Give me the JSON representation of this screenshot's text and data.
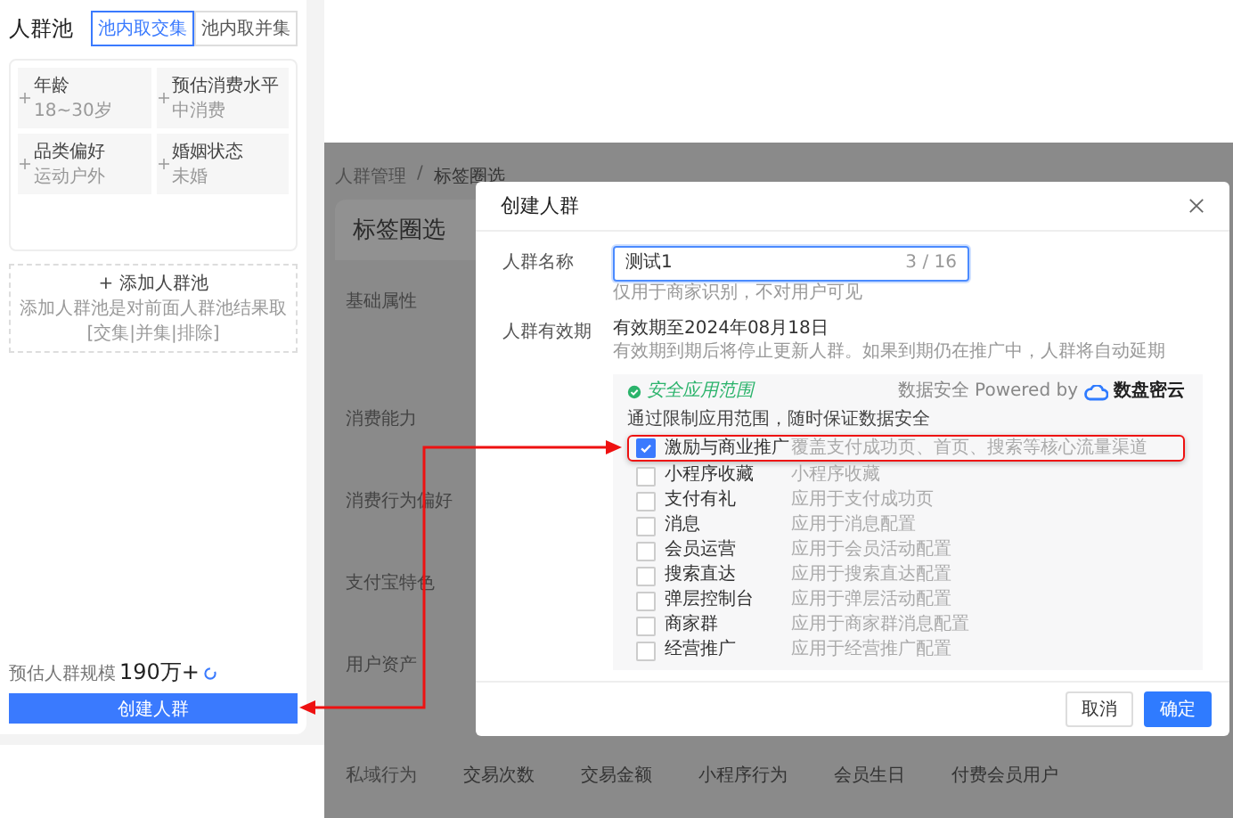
{
  "pool_panel": {
    "title": "人群池",
    "tabs": [
      {
        "label": "池内取交集",
        "selected": true
      },
      {
        "label": "池内取并集",
        "selected": false
      }
    ],
    "conditions": [
      {
        "name": "年龄",
        "value": "18~30岁"
      },
      {
        "name": "预估消费水平",
        "value": "中消费"
      },
      {
        "name": "品类偏好",
        "value": "运动户外"
      },
      {
        "name": "婚姻状态",
        "value": "未婚"
      }
    ],
    "add_button": "+ 添加人群池",
    "add_hint": "添加人群池是对前面人群池结果取 [交集|并集|排除]",
    "estimate_label": "预估人群规模",
    "estimate_value": "190万+",
    "create_button": "创建人群"
  },
  "page": {
    "breadcrumb": [
      "人群管理",
      "标签圈选"
    ],
    "breadcrumb_separator": "/",
    "card_title": "标签圈选",
    "categories": [
      {
        "label": "基础属性"
      },
      {
        "label": "消费能力"
      },
      {
        "label": "消费行为偏好"
      },
      {
        "label": "支付宝特色"
      },
      {
        "label": "用户资产"
      },
      {
        "label": "私域行为",
        "items": [
          "交易次数",
          "交易金额",
          "小程序行为",
          "会员生日",
          "付费会员用户"
        ]
      }
    ]
  },
  "dialog": {
    "title": "创建人群",
    "name_field": {
      "label": "人群名称",
      "value": "测试1",
      "counter": "3 / 16",
      "hint": "仅用于商家识别，不对用户可见"
    },
    "validity": {
      "label": "人群有效期",
      "value": "有效期至2024年08月18日",
      "hint": "有效期到期后将停止更新人群。如果到期仍在推广中，人群将自动延期"
    },
    "scope": {
      "title": "安全应用范围",
      "powered_by": "数据安全 Powered by",
      "brand": "数盘密云",
      "intro": "通过限制应用范围，随时保证数据安全",
      "options": [
        {
          "name": "激励与商业推广",
          "description": "覆盖支付成功页、首页、搜索等核心流量渠道",
          "checked": true,
          "highlighted": true
        },
        {
          "name": "小程序收藏",
          "description": "小程序收藏",
          "checked": false,
          "highlighted": false
        },
        {
          "name": "支付有礼",
          "description": "应用于支付成功页",
          "checked": false,
          "highlighted": false
        },
        {
          "name": "消息",
          "description": "应用于消息配置",
          "checked": false,
          "highlighted": false
        },
        {
          "name": "会员运营",
          "description": "应用于会员活动配置",
          "checked": false,
          "highlighted": false
        },
        {
          "name": "搜索直达",
          "description": "应用于搜索直达配置",
          "checked": false,
          "highlighted": false
        },
        {
          "name": "弹层控制台",
          "description": "应用于弹层活动配置",
          "checked": false,
          "highlighted": false
        },
        {
          "name": "商家群",
          "description": "应用于商家群消息配置",
          "checked": false,
          "highlighted": false
        },
        {
          "name": "经营推广",
          "description": "应用于经营推广配置",
          "checked": false,
          "highlighted": false
        }
      ]
    },
    "buttons": [
      {
        "label": "取消",
        "kind": "secondary"
      },
      {
        "label": "确定",
        "kind": "primary"
      }
    ]
  }
}
